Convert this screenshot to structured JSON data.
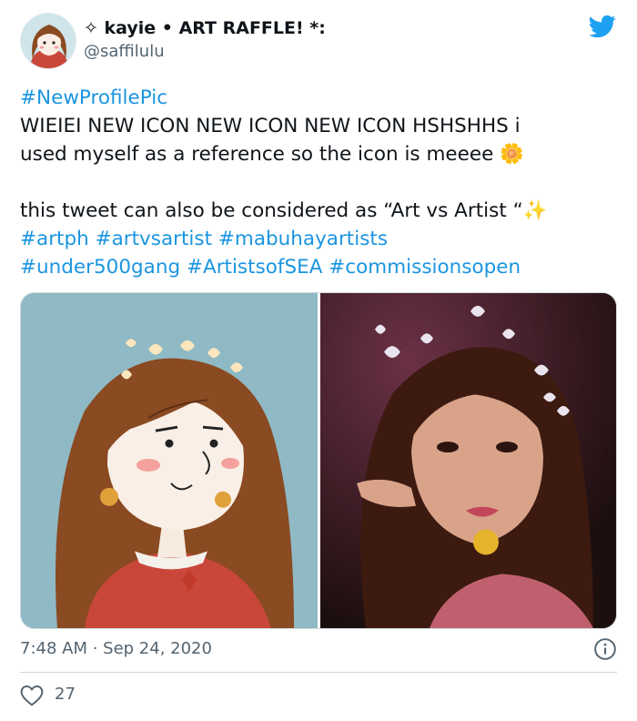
{
  "tweet": {
    "display_name": "✧ kayie • ART RAFFLE! *:",
    "handle": "@saffilulu",
    "lines": [
      {
        "tag": "#NewProfilePic"
      },
      {
        "text": "WIEIEI NEW ICON NEW ICON NEW ICON HSHSHHS i"
      },
      {
        "text": "used myself as a reference so the icon is meeee 🌼"
      },
      {
        "text": "this tweet can also be considered as “Art vs Artist “✨"
      },
      {
        "tags": [
          "#artph",
          "#artvsartist",
          "#mabuhayartists"
        ]
      },
      {
        "tags": [
          " #under500gang",
          "#ArtistsofSEA",
          "#commissionsopen"
        ]
      }
    ],
    "timestamp": "7:48 AM · Sep 24, 2020",
    "like_count": "27"
  },
  "icons": {
    "logo": "twitter-bird-icon",
    "info": "info-icon",
    "like": "heart-icon"
  },
  "colors": {
    "link": "#1b95e0",
    "twitter_blue": "#1da1f2",
    "muted": "#536471",
    "border": "#cfd9de"
  }
}
